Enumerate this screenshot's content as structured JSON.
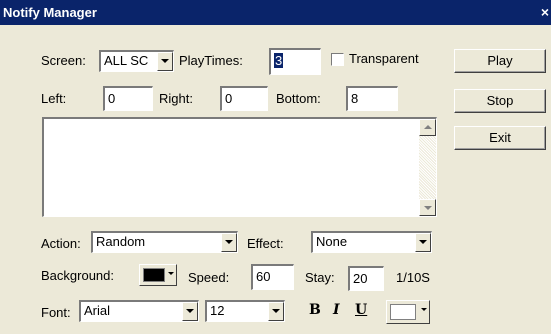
{
  "window": {
    "title": "Notify Manager",
    "close_glyph": "×"
  },
  "row1": {
    "screen_label": "Screen:",
    "screen_value": "ALL SC",
    "playtimes_label": "PlayTimes:",
    "playtimes_value": "3",
    "transparent_label": "Transparent"
  },
  "row2": {
    "left_label": "Left:",
    "left_value": "0",
    "right_label": "Right:",
    "right_value": "0",
    "bottom_label": "Bottom:",
    "bottom_value": "8"
  },
  "buttons": {
    "play": "Play",
    "stop": "Stop",
    "exit": "Exit"
  },
  "message_text": "",
  "row_action": {
    "action_label": "Action:",
    "action_value": "Random",
    "effect_label": "Effect:",
    "effect_value": "None"
  },
  "row_background": {
    "background_label": "Background:",
    "background_color": "#000000",
    "speed_label": "Speed:",
    "speed_value": "60",
    "stay_label": "Stay:",
    "stay_value": "20",
    "stay_unit": "1/10S"
  },
  "row_font": {
    "font_label": "Font:",
    "font_value": "Arial",
    "size_value": "12",
    "bold_glyph": "B",
    "italic_glyph": "I",
    "underline_glyph": "U",
    "font_color": "#ffffff"
  },
  "colors": {
    "titlebar": "#0a246a",
    "dialog_bg": "#ece9d8"
  }
}
